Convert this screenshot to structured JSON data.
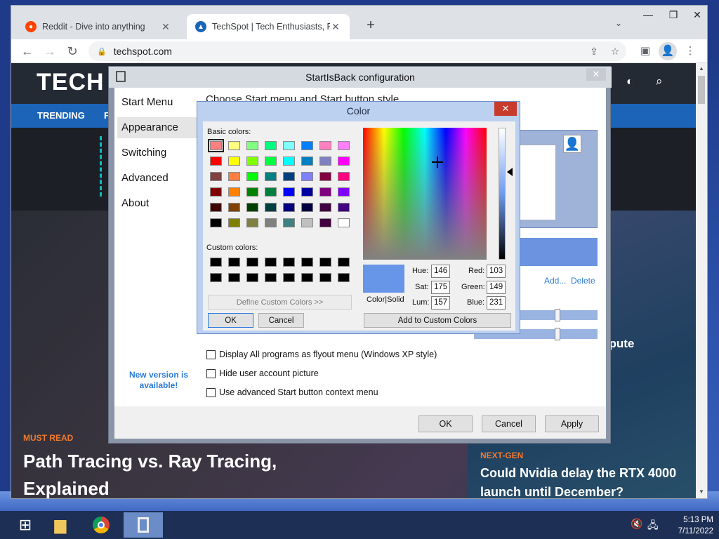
{
  "browser": {
    "tabs": [
      {
        "title": "Reddit - Dive into anything",
        "favicon": "reddit-icon",
        "active": false
      },
      {
        "title": "TechSpot | Tech Enthusiasts, Pow",
        "favicon": "techspot-icon",
        "active": true
      }
    ],
    "url": "techspot.com"
  },
  "site": {
    "logo": "TECH",
    "nav": [
      "TRENDING",
      "F"
    ],
    "kicker_left": "MUST READ",
    "headline_left": "Path Tracing vs. Ray Tracing, Explained",
    "kicker_right": "NEXT-GEN",
    "headline_right": "Could Nvidia delay the RTX 4000 launch until December?",
    "partial_headline": "ompute"
  },
  "sib": {
    "title": "StartIsBack configuration",
    "heading": "Choose Start menu and Start button style",
    "sidebar": [
      "Start Menu",
      "Appearance",
      "Switching",
      "Advanced",
      "About"
    ],
    "selected": "Appearance",
    "new_version": "New version is available!",
    "add_link": "Add...",
    "delete_link": "Delete",
    "checkboxes": [
      {
        "label": "Display All programs as flyout menu (Windows XP style)",
        "checked": false
      },
      {
        "label": "Hide user account picture",
        "checked": false
      },
      {
        "label": "Use advanced Start button context menu",
        "checked": false
      }
    ],
    "buttons": {
      "ok": "OK",
      "cancel": "Cancel",
      "apply": "Apply"
    }
  },
  "color_dialog": {
    "title": "Color",
    "basic_label": "Basic colors:",
    "custom_label": "Custom colors:",
    "define_custom": "Define Custom Colors >>",
    "ok": "OK",
    "cancel": "Cancel",
    "add_custom": "Add to Custom Colors",
    "color_solid": "Color|Solid",
    "basic_colors": [
      "#ff8080",
      "#ffff80",
      "#80ff80",
      "#00ff80",
      "#80ffff",
      "#0080ff",
      "#ff80c0",
      "#ff80ff",
      "#ff0000",
      "#ffff00",
      "#80ff00",
      "#00ff40",
      "#00ffff",
      "#0080c0",
      "#8080c0",
      "#ff00ff",
      "#804040",
      "#ff8040",
      "#00ff00",
      "#008080",
      "#004080",
      "#8080ff",
      "#800040",
      "#ff0080",
      "#800000",
      "#ff8000",
      "#008000",
      "#008040",
      "#0000ff",
      "#0000a0",
      "#800080",
      "#8000ff",
      "#400000",
      "#804000",
      "#004000",
      "#004040",
      "#000080",
      "#000040",
      "#400040",
      "#400080",
      "#000000",
      "#808000",
      "#808040",
      "#808080",
      "#408080",
      "#c0c0c0",
      "#400040",
      "#ffffff"
    ],
    "selected_index": 0,
    "hue_label": "Hue:",
    "hue": "146",
    "sat_label": "Sat:",
    "sat": "175",
    "lum_label": "Lum:",
    "lum": "157",
    "red_label": "Red:",
    "red": "103",
    "green_label": "Green:",
    "green": "149",
    "blue_label": "Blue:",
    "blue": "231",
    "current_color": "#6795e7"
  },
  "taskbar": {
    "time": "5:13 PM",
    "date": "7/11/2022"
  }
}
